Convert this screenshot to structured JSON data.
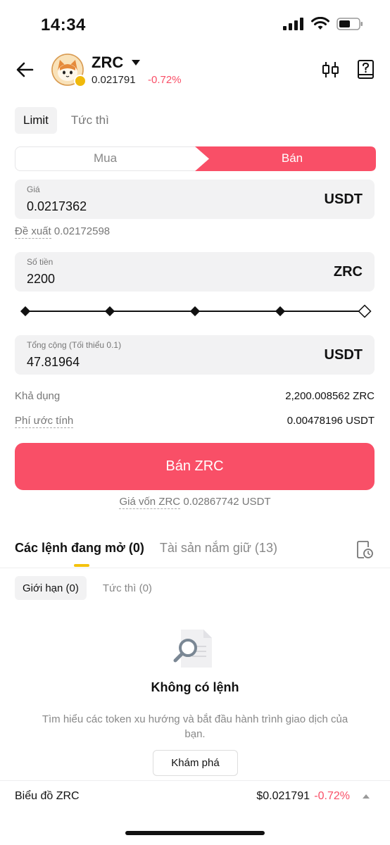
{
  "status": {
    "time": "14:34"
  },
  "header": {
    "token_name": "ZRC",
    "price": "0.021791",
    "change": "-0.72%",
    "negative_color": "#f94f67"
  },
  "order_type_tabs": [
    {
      "label": "Limit"
    },
    {
      "label": "Tức thì"
    }
  ],
  "side_toggle": {
    "buy_label": "Mua",
    "sell_label": "Bán",
    "sell_color": "#f94f67"
  },
  "price_field": {
    "label": "Giá",
    "value": "0.0217362",
    "unit": "USDT"
  },
  "suggestion": {
    "label": "Đề xuất",
    "value": "0.02172598"
  },
  "amount_field": {
    "label": "Số tiền",
    "value": "2200",
    "unit": "ZRC"
  },
  "amount_slider": {
    "level_percent": 100
  },
  "total_field": {
    "label": "Tổng cộng (Tối thiểu 0.1)",
    "value": "47.81964",
    "unit": "USDT"
  },
  "available": {
    "label": "Khả dụng",
    "value": "2,200.008562 ZRC"
  },
  "fee": {
    "label": "Phí ước tính",
    "value": "0.00478196 USDT"
  },
  "sell_button": {
    "label": "Bán ZRC"
  },
  "cost_basis": {
    "label": "Giá vốn ZRC",
    "value": "0.02867742 USDT"
  },
  "list_tabs": [
    {
      "label": "Các lệnh đang mở (0)"
    },
    {
      "label": "Tài sản nắm giữ (13)"
    }
  ],
  "sub_tabs": [
    {
      "label": "Giới hạn (0)"
    },
    {
      "label": "Tức thì (0)"
    }
  ],
  "empty_state": {
    "title": "Không có lệnh",
    "description": "Tìm hiểu các token xu hướng và bắt đầu hành trình giao dịch của bạn.",
    "button_label": "Khám phá"
  },
  "chart_bar": {
    "title": "Biểu đồ ZRC",
    "price": "$0.021791",
    "change": "-0.72%"
  }
}
